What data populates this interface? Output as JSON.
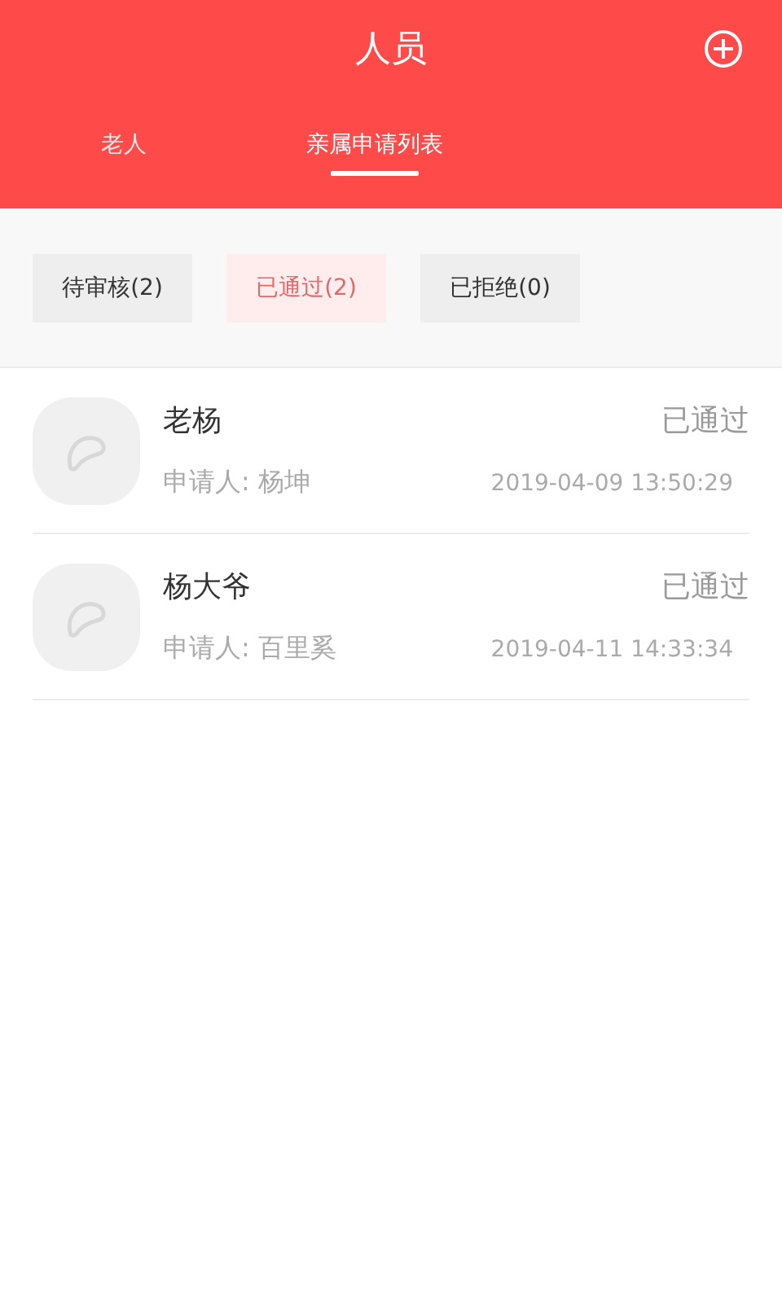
{
  "header": {
    "title": "人员"
  },
  "tabs": [
    {
      "label": "老人",
      "selected": false
    },
    {
      "label": "亲属申请列表",
      "selected": true
    }
  ],
  "filters": [
    {
      "label": "待审核(2)",
      "selected": false
    },
    {
      "label": "已通过(2)",
      "selected": true
    },
    {
      "label": "已拒绝(0)",
      "selected": false
    }
  ],
  "applications": [
    {
      "name": "老杨",
      "status": "已通过",
      "applicant": "申请人: 杨坤",
      "time": "2019-04-09 13:50:29"
    },
    {
      "name": "杨大爷",
      "status": "已通过",
      "applicant": "申请人: 百里奚",
      "time": "2019-04-11 14:33:34"
    }
  ]
}
